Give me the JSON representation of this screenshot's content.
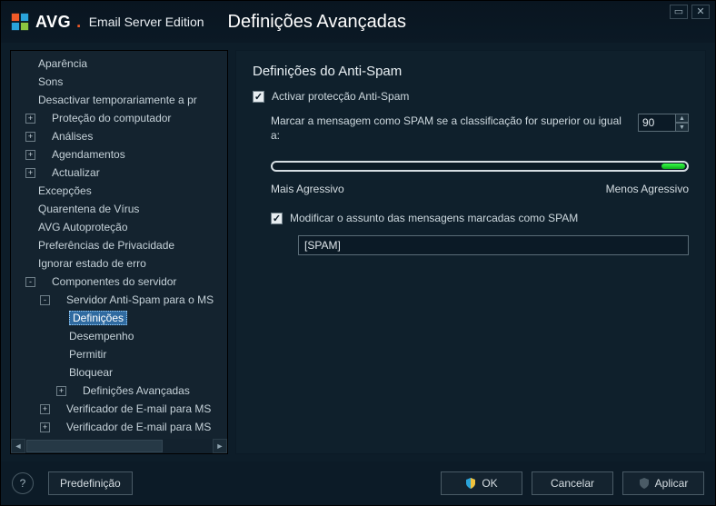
{
  "logo": {
    "brand": "AVG",
    "dot": ".",
    "product": "Email Server Edition"
  },
  "title": "Definições Avançadas",
  "winctrls": {
    "minimize": "▭",
    "close": "✕"
  },
  "tree": [
    {
      "label": "Aparência",
      "level": 0,
      "twisty": null
    },
    {
      "label": "Sons",
      "level": 0,
      "twisty": null
    },
    {
      "label": "Desactivar temporariamente a pr",
      "level": 0,
      "twisty": null
    },
    {
      "label": "Proteção do computador",
      "level": 0,
      "twisty": "+"
    },
    {
      "label": "Análises",
      "level": 0,
      "twisty": "+"
    },
    {
      "label": "Agendamentos",
      "level": 0,
      "twisty": "+"
    },
    {
      "label": "Actualizar",
      "level": 0,
      "twisty": "+"
    },
    {
      "label": "Excepções",
      "level": 0,
      "twisty": null
    },
    {
      "label": "Quarentena de Vírus",
      "level": 0,
      "twisty": null
    },
    {
      "label": "AVG Autoproteção",
      "level": 0,
      "twisty": null
    },
    {
      "label": "Preferências de Privacidade",
      "level": 0,
      "twisty": null
    },
    {
      "label": "Ignorar estado de erro",
      "level": 0,
      "twisty": null
    },
    {
      "label": "Componentes do servidor",
      "level": 0,
      "twisty": "-"
    },
    {
      "label": "Servidor Anti-Spam para o MS",
      "level": 1,
      "twisty": "-"
    },
    {
      "label": "Definições",
      "level": 2,
      "twisty": null,
      "selected": true
    },
    {
      "label": "Desempenho",
      "level": 2,
      "twisty": null
    },
    {
      "label": "Permitir",
      "level": 2,
      "twisty": null
    },
    {
      "label": "Bloquear",
      "level": 2,
      "twisty": null
    },
    {
      "label": "Definições Avançadas",
      "level": 2,
      "twisty": "+"
    },
    {
      "label": "Verificador de E-mail para MS",
      "level": 1,
      "twisty": "+"
    },
    {
      "label": "Verificador de E-mail para MS",
      "level": 1,
      "twisty": "+"
    }
  ],
  "content": {
    "section_title": "Definições do Anti-Spam",
    "enable_label": "Activar protecção Anti-Spam",
    "score_label": "Marcar a mensagem como SPAM se a classificação for superior ou igual a:",
    "score_value": "90",
    "slider_left": "Mais Agressivo",
    "slider_right": "Menos Agressivo",
    "modify_subject_label": "Modificar o assunto das mensagens marcadas como SPAM",
    "subject_value": "[SPAM]"
  },
  "footer": {
    "preset": "Predefinição",
    "ok": "OK",
    "cancel": "Cancelar",
    "apply": "Aplicar"
  }
}
